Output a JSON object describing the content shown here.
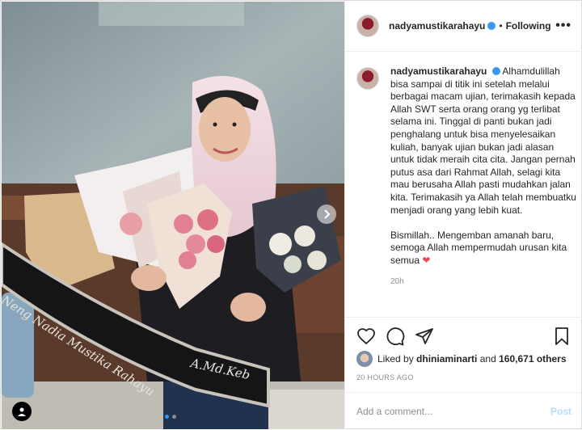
{
  "post": {
    "username": "nadyamustikarahayu",
    "header_separator": "•",
    "follow_status": "Following",
    "more_label": "•••",
    "caption_username": "nadyamustikarahayu",
    "caption_text": "Alhamdulillah bisa sampai di titik ini setelah melalui berbagai macam ujian, terimakasih kepada Allah SWT serta orang orang yg terlibat selama ini. Tinggal di panti bukan jadi penghalang untuk bisa menyelesaikan kuliah, banyak ujian bukan jadi alasan untuk tidak meraih cita cita. Jangan pernah putus asa dari Rahmat Allah, selagi kita mau berusaha Allah pasti mudahkan jalan kita. Terimakasih ya Allah telah membuatku menjadi orang yang lebih kuat.\n\nBismillah.. Mengemban amanah baru, semoga Allah mempermudah urusan kita semua ",
    "caption_heart": "❤",
    "caption_time": "20h",
    "liked_by_prefix": "Liked by ",
    "liked_by_user": "dhiniaminarti",
    "liked_by_and": " and ",
    "liked_by_count": "160,671 others",
    "time_ago": "20 HOURS AGO",
    "comment_placeholder": "Add a comment...",
    "post_label": "Post",
    "carousel_index": 1,
    "carousel_total": 2
  },
  "photo": {
    "sash_line1": "Neng Nadia Mustika Rahayu",
    "sash_line2": "A.Md.Keb"
  },
  "icons": {
    "like": "heart-icon",
    "comment": "comment-icon",
    "share": "share-icon",
    "save": "bookmark-icon",
    "next": "chevron-right-icon",
    "tag": "user-tag-icon"
  },
  "colors": {
    "link": "#3897f0",
    "heart": "#ed4956",
    "post_disabled": "#b2dffc",
    "meta": "#8e8e8e"
  }
}
